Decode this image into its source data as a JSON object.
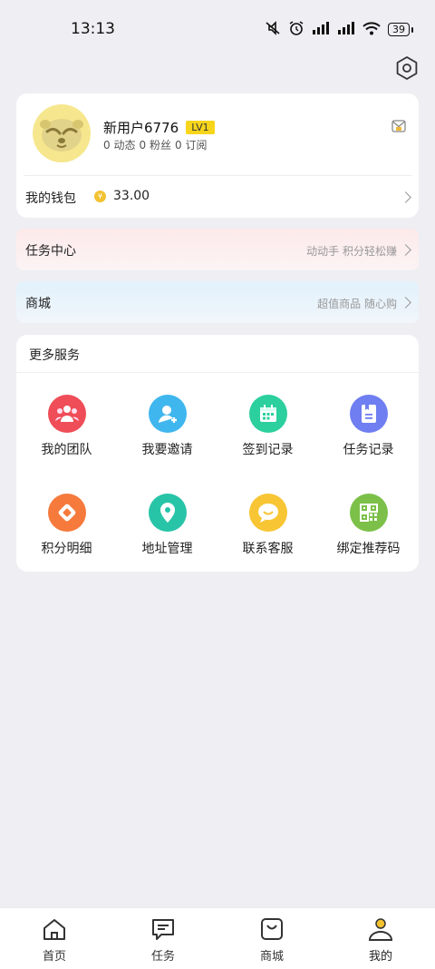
{
  "status_bar": {
    "time": "13:13",
    "battery": "39"
  },
  "profile": {
    "username": "新用户6776",
    "level": "LV1",
    "stats": [
      {
        "count": "0",
        "label": "动态"
      },
      {
        "count": "0",
        "label": "粉丝"
      },
      {
        "count": "0",
        "label": "订阅"
      }
    ]
  },
  "wallet": {
    "label": "我的钱包",
    "coin_symbol": "¥",
    "amount": "33.00"
  },
  "task_center": {
    "title": "任务中心",
    "subtitle": "动动手 积分轻松赚"
  },
  "mall": {
    "title": "商城",
    "subtitle": "超值商品 随心购"
  },
  "services": {
    "title": "更多服务",
    "items": [
      {
        "label": "我的团队",
        "icon": "team-icon",
        "color": "#ef4d57"
      },
      {
        "label": "我要邀请",
        "icon": "invite-icon",
        "color": "#3fb6ee"
      },
      {
        "label": "签到记录",
        "icon": "calendar-icon",
        "color": "#2ccf9e"
      },
      {
        "label": "任务记录",
        "icon": "task-record-icon",
        "color": "#6f7ef0"
      },
      {
        "label": "积分明细",
        "icon": "points-icon",
        "color": "#f57a3c"
      },
      {
        "label": "地址管理",
        "icon": "location-icon",
        "color": "#27c4a8"
      },
      {
        "label": "联系客服",
        "icon": "customer-service-icon",
        "color": "#f8c534"
      },
      {
        "label": "绑定推荐码",
        "icon": "qr-code-icon",
        "color": "#7cc04a"
      }
    ]
  },
  "tabbar": {
    "items": [
      {
        "label": "首页",
        "icon": "home-icon"
      },
      {
        "label": "任务",
        "icon": "task-icon"
      },
      {
        "label": "商城",
        "icon": "shop-icon"
      },
      {
        "label": "我的",
        "icon": "profile-icon",
        "active": true
      }
    ]
  },
  "colors": {
    "background": "#eeeef3",
    "level_badge": "#f7d51c",
    "coin": "#f3c230",
    "active_tab_accent": "#f3c230"
  }
}
